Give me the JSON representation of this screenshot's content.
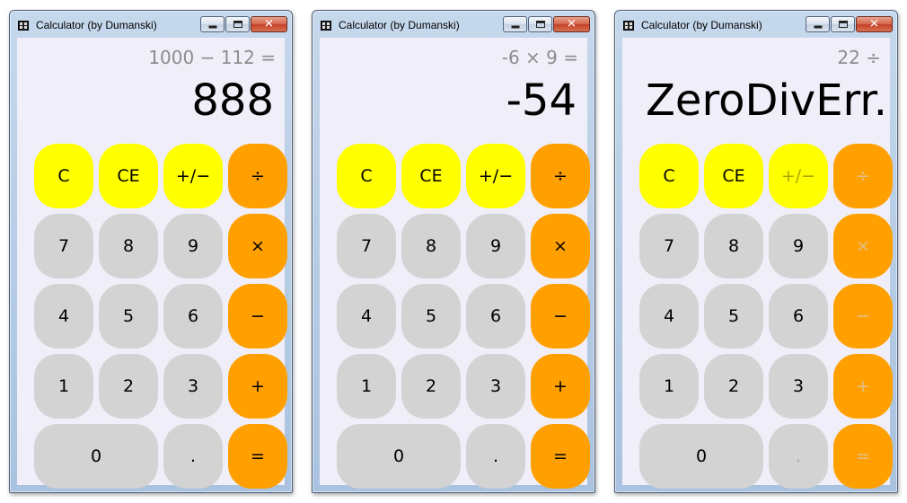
{
  "windows": [
    {
      "title": "Calculator (by Dumanski)",
      "expression": "1000 − 112 =",
      "result": "888",
      "buttons": {
        "c": "C",
        "ce": "CE",
        "sign": "+/−",
        "divide": "÷",
        "seven": "7",
        "eight": "8",
        "nine": "9",
        "multiply": "×",
        "four": "4",
        "five": "5",
        "six": "6",
        "minus": "−",
        "one": "1",
        "two": "2",
        "three": "3",
        "plus": "+",
        "zero": "0",
        "dot": ".",
        "equals": "="
      }
    },
    {
      "title": "Calculator (by Dumanski)",
      "expression": "-6 × 9 =",
      "result": "-54",
      "buttons": {
        "c": "C",
        "ce": "CE",
        "sign": "+/−",
        "divide": "÷",
        "seven": "7",
        "eight": "8",
        "nine": "9",
        "multiply": "×",
        "four": "4",
        "five": "5",
        "six": "6",
        "minus": "−",
        "one": "1",
        "two": "2",
        "three": "3",
        "plus": "+",
        "zero": "0",
        "dot": ".",
        "equals": "="
      }
    },
    {
      "title": "Calculator (by Dumanski)",
      "expression": "22 ÷",
      "result": "ZeroDivErr.",
      "buttons": {
        "c": "C",
        "ce": "CE",
        "sign": "+/−",
        "divide": "÷",
        "seven": "7",
        "eight": "8",
        "nine": "9",
        "multiply": "×",
        "four": "4",
        "five": "5",
        "six": "6",
        "minus": "−",
        "one": "1",
        "two": "2",
        "three": "3",
        "plus": "+",
        "zero": "0",
        "dot": ".",
        "equals": "="
      },
      "disabled_buttons": [
        "sign",
        "divide",
        "multiply",
        "minus",
        "plus",
        "dot",
        "equals"
      ]
    }
  ],
  "window_controls": {
    "close_glyph": "✕"
  },
  "colors": {
    "function_buttons": "#ffff00",
    "digit_buttons": "#d3d3d3",
    "operator_buttons": "#ffa000",
    "display_background": "#f0eef8",
    "expression_text": "#8c8c8c"
  }
}
